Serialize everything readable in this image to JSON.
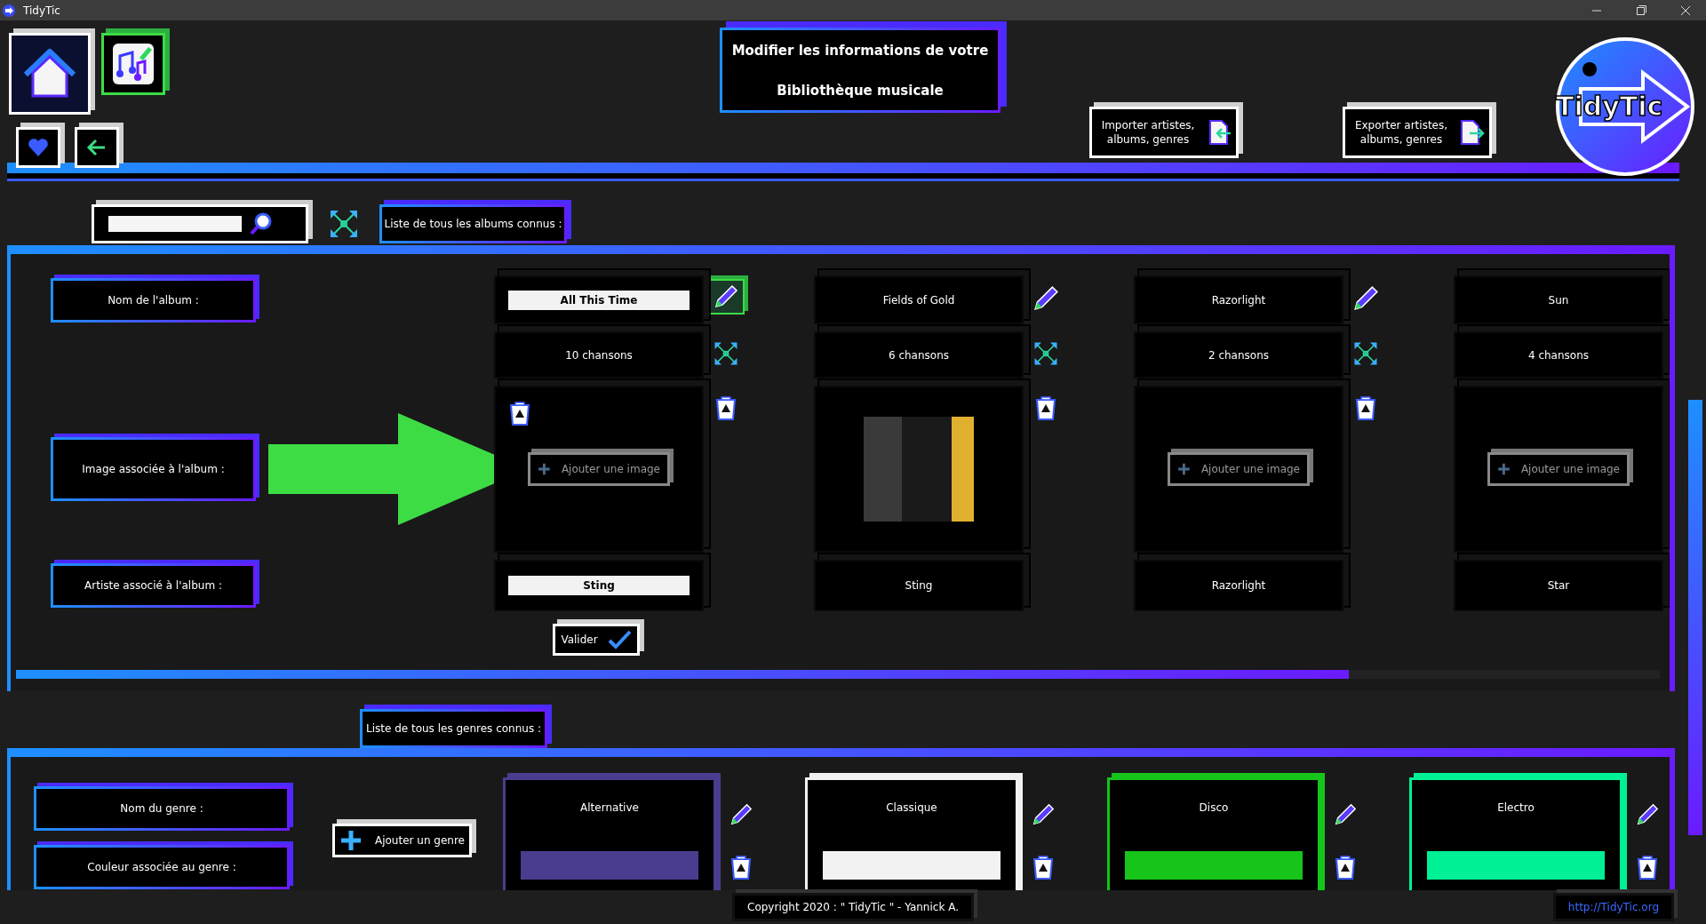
{
  "window": {
    "title": "TidyTic"
  },
  "header": {
    "title_line_1": "Modifier les informations de votre",
    "title_line_2": "Bibliothèque musicale",
    "import_button": "Importer artistes, albums, genres",
    "export_button": "Exporter artistes, albums, genres",
    "logo_text": "TidyTic"
  },
  "albums": {
    "tab": "Liste de tous les albums connus :",
    "labels": [
      "Nom de l'album :",
      "Image associée à l'album :",
      "Artiste associé à l'album :"
    ],
    "columns": [
      {
        "name": "All This Time",
        "songs": "10 chansons",
        "artist": "Sting",
        "editing": true,
        "has_cover": false,
        "add_image": "Ajouter une image"
      },
      {
        "name": "Fields of Gold",
        "songs": "6 chansons",
        "artist": "Sting",
        "editing": false,
        "has_cover": true
      },
      {
        "name": "Razorlight",
        "songs": "2 chansons",
        "artist": "Razorlight",
        "editing": false,
        "has_cover": false,
        "add_image": "Ajouter une image"
      },
      {
        "name": "Sun",
        "songs": "4 chansons",
        "artist": "Star",
        "editing": false,
        "has_cover": false,
        "add_image": "Ajouter une image"
      }
    ],
    "validate_button": "Valider"
  },
  "genres": {
    "tab": "Liste de tous les genres connus :",
    "labels": [
      "Nom du genre :",
      "Couleur associée au genre :"
    ],
    "add_button": "Ajouter un genre",
    "list": [
      {
        "name": "Alternative",
        "color": "#4a3d8f"
      },
      {
        "name": "Classique",
        "color": "#f2f2f2"
      },
      {
        "name": "Disco",
        "color": "#16c41a"
      },
      {
        "name": "Electro",
        "color": "#00f096"
      }
    ]
  },
  "footer": {
    "copyright": "Copyright 2020 : \" TidyTic \" - Yannick A.",
    "link": "http://TidyTic.org"
  }
}
